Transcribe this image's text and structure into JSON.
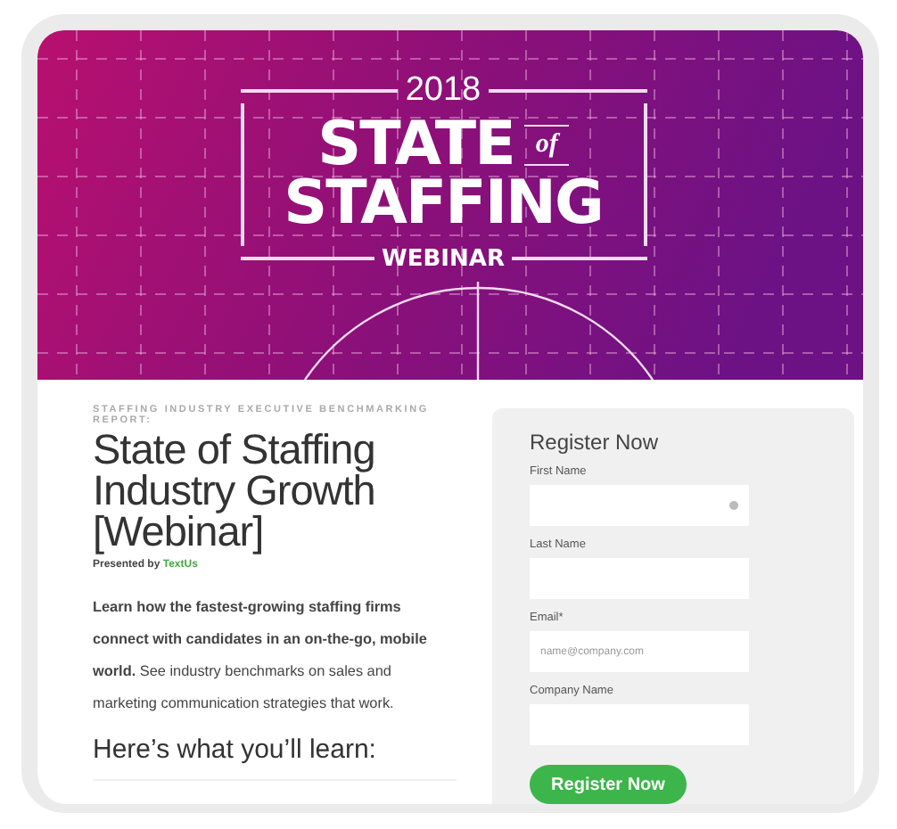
{
  "banner": {
    "year": "2018",
    "title_line_1": "STATE",
    "of": "of",
    "title_line_2": "STAFFING",
    "subtitle": "WEBINAR"
  },
  "article": {
    "kicker": "STAFFING INDUSTRY EXECUTIVE BENCHMARKING REPORT:",
    "title": "State of Staffing Industry Growth [Webinar]",
    "presenter_label": "Presented by",
    "presenter_link": "TextUs",
    "body": "**Learn how the fastest-growing staffing firms connect with candidates in an on-the-go, mobile world.** See industry benchmarks on sales and marketing communication strategies that work.",
    "learn_heading": "Here’s what you’ll learn:"
  },
  "form": {
    "title": "Register Now",
    "fields": [
      {
        "label": "First Name",
        "kind": "autofill"
      },
      {
        "label": "Last Name",
        "kind": "text"
      },
      {
        "label": "Email*",
        "kind": "text",
        "placeholder": "name@company.com"
      },
      {
        "label": "Company Name",
        "kind": "text"
      }
    ],
    "button": "Register Now"
  }
}
